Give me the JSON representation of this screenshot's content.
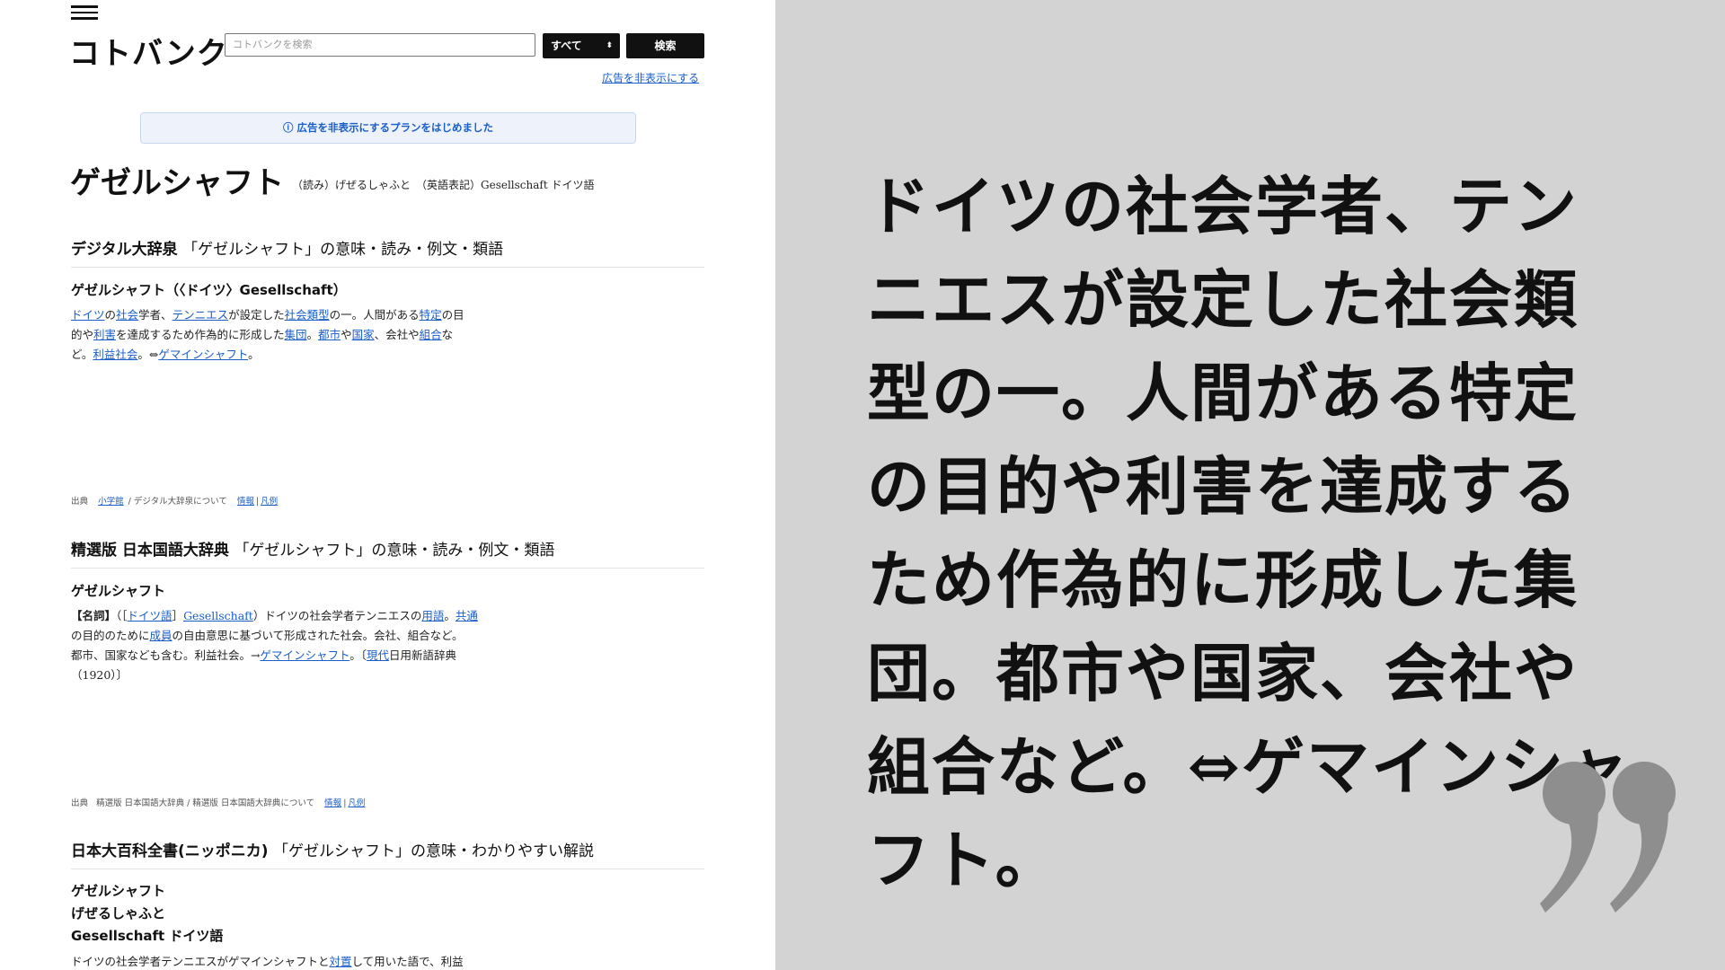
{
  "header": {
    "logo": "コトバンク",
    "search_placeholder": "コトバンクを検索",
    "scope_label": "すべて",
    "search_button": "検索",
    "hide_ads_link": "広告を非表示にする"
  },
  "notice": {
    "text": "ⓘ 広告を非表示にするプランをはじめました"
  },
  "term": {
    "headword": "ゲゼルシャフト",
    "reading": "（読み）げぜるしゃふと　（英語表記）Gesellschaft ドイツ語"
  },
  "sections": [
    {
      "title_source": "デジタル大辞泉",
      "title_rest": "「ゲゼルシャフト」の意味・読み・例文・類語",
      "entry_head": "ゲゼルシャフト（〈ドイツ〉Gesellschaft）",
      "body_lines": [
        "ドイツの社会学者、テンニエスが設定した社会類型の一。人間がある特定の目",
        "的や利害を達成するため作為的に形成した集団。都市や国家、会社や組合な",
        "ど。利益社会。⇔ゲマインシャフト。"
      ],
      "source": {
        "label": "出典",
        "publisher": "小学館",
        "about": "デジタル大辞泉について",
        "info_link": "情報",
        "legend_link": "凡例"
      }
    },
    {
      "title_source": "精選版 日本国語大辞典",
      "title_rest": "「ゲゼルシャフト」の意味・読み・例文・類語",
      "entry_head": "ゲゼルシャフト",
      "body_lines": [
        "【名詞】（［ドイツ語］Gesellschaft）ドイツの社会学者テンニエスの用語。共通",
        "の目的のために成員の自由意思に基づいて形成された社会。会社、組合など。",
        "都市、国家なども含む。利益社会。→ゲマインシャフト。〔現代日用新語辞典",
        "（1920）〕"
      ],
      "source": {
        "label": "出典",
        "publisher": "精選版 日本国語大辞典",
        "about": "精選版 日本国語大辞典について",
        "info_link": "情報",
        "legend_link": "凡例"
      }
    },
    {
      "title_source": "日本大百科全書(ニッポニカ)",
      "title_rest": "「ゲゼルシャフト」の意味・わかりやすい解説",
      "entry_head_lines": [
        "ゲゼルシャフト",
        "げぜるしゃふと",
        "Gesellschaft ドイツ語"
      ],
      "body_first_line": "ドイツの社会学者テンニエスがゲマインシャフトと対置して用いた語で、利益"
    }
  ],
  "quote": {
    "text": "ドイツの社会学者、テンニエスが設定した社会類型の一。人間がある特定の目的や利害を達成するため作為的に形成した集団。都市や国家、会社や組合など。⇔ゲマインシャフト。"
  },
  "colors": {
    "link": "#1a5ec9",
    "panel_bg": "#d3d3d3",
    "quote_mark": "#8e8e8e"
  }
}
